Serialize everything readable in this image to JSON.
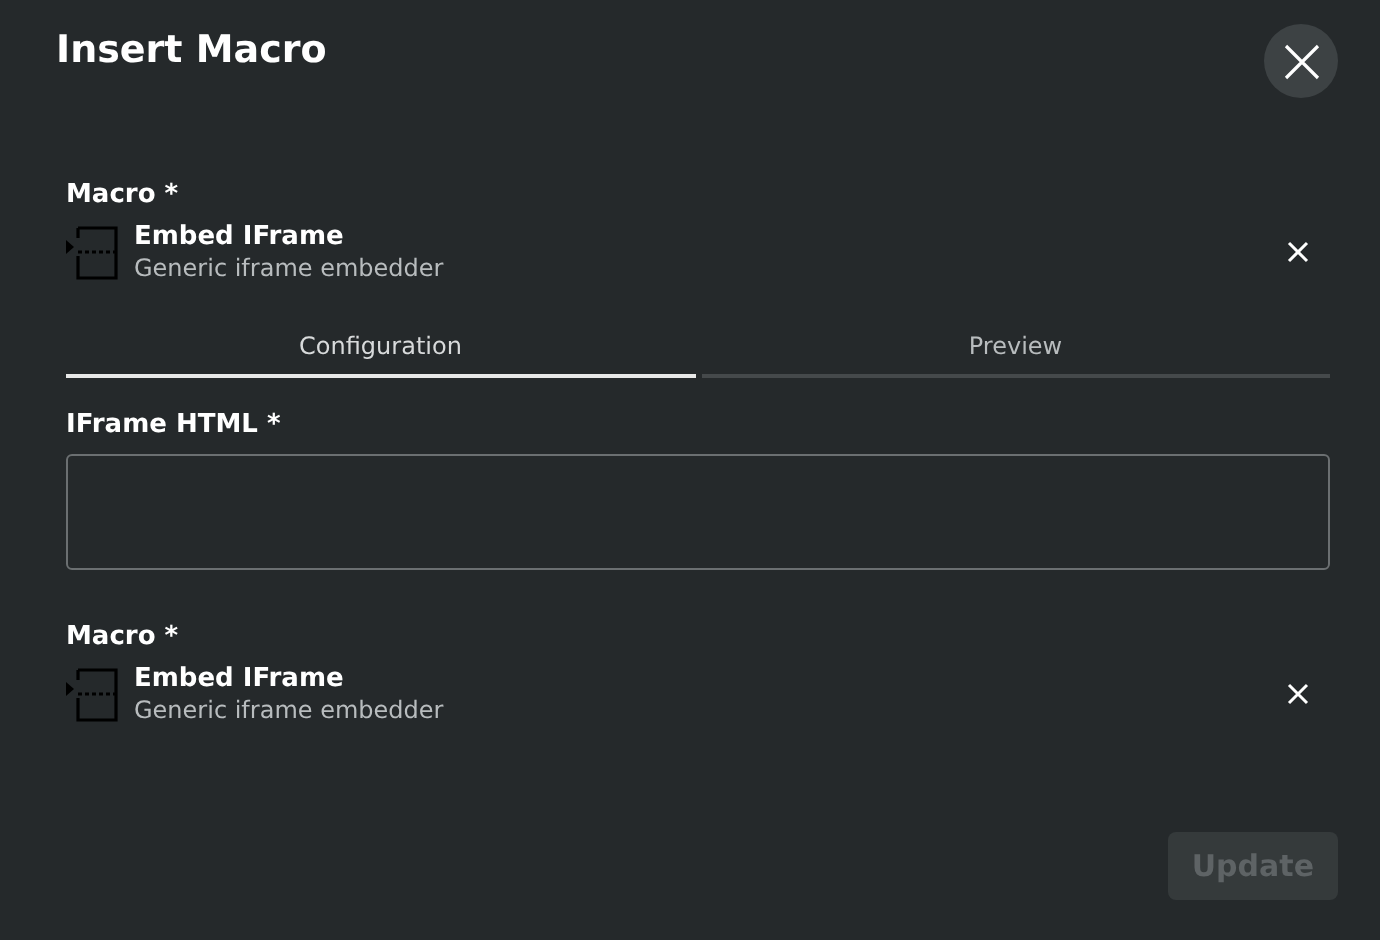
{
  "dialog": {
    "title": "Insert Macro"
  },
  "items": [
    {
      "kind": "macro",
      "label": "Macro *",
      "name": "Embed IFrame",
      "description": "Generic iframe embedder"
    },
    {
      "kind": "tabs",
      "tabs": [
        {
          "label": "Configuration",
          "selected": true
        },
        {
          "label": "Preview",
          "selected": false
        }
      ]
    },
    {
      "kind": "textarea",
      "label": "IFrame HTML *"
    },
    {
      "kind": "macro",
      "label": "Macro *",
      "name": "Embed IFrame",
      "description": "Generic iframe embedder"
    }
  ],
  "button": {
    "label": "Update",
    "disabled": true
  }
}
